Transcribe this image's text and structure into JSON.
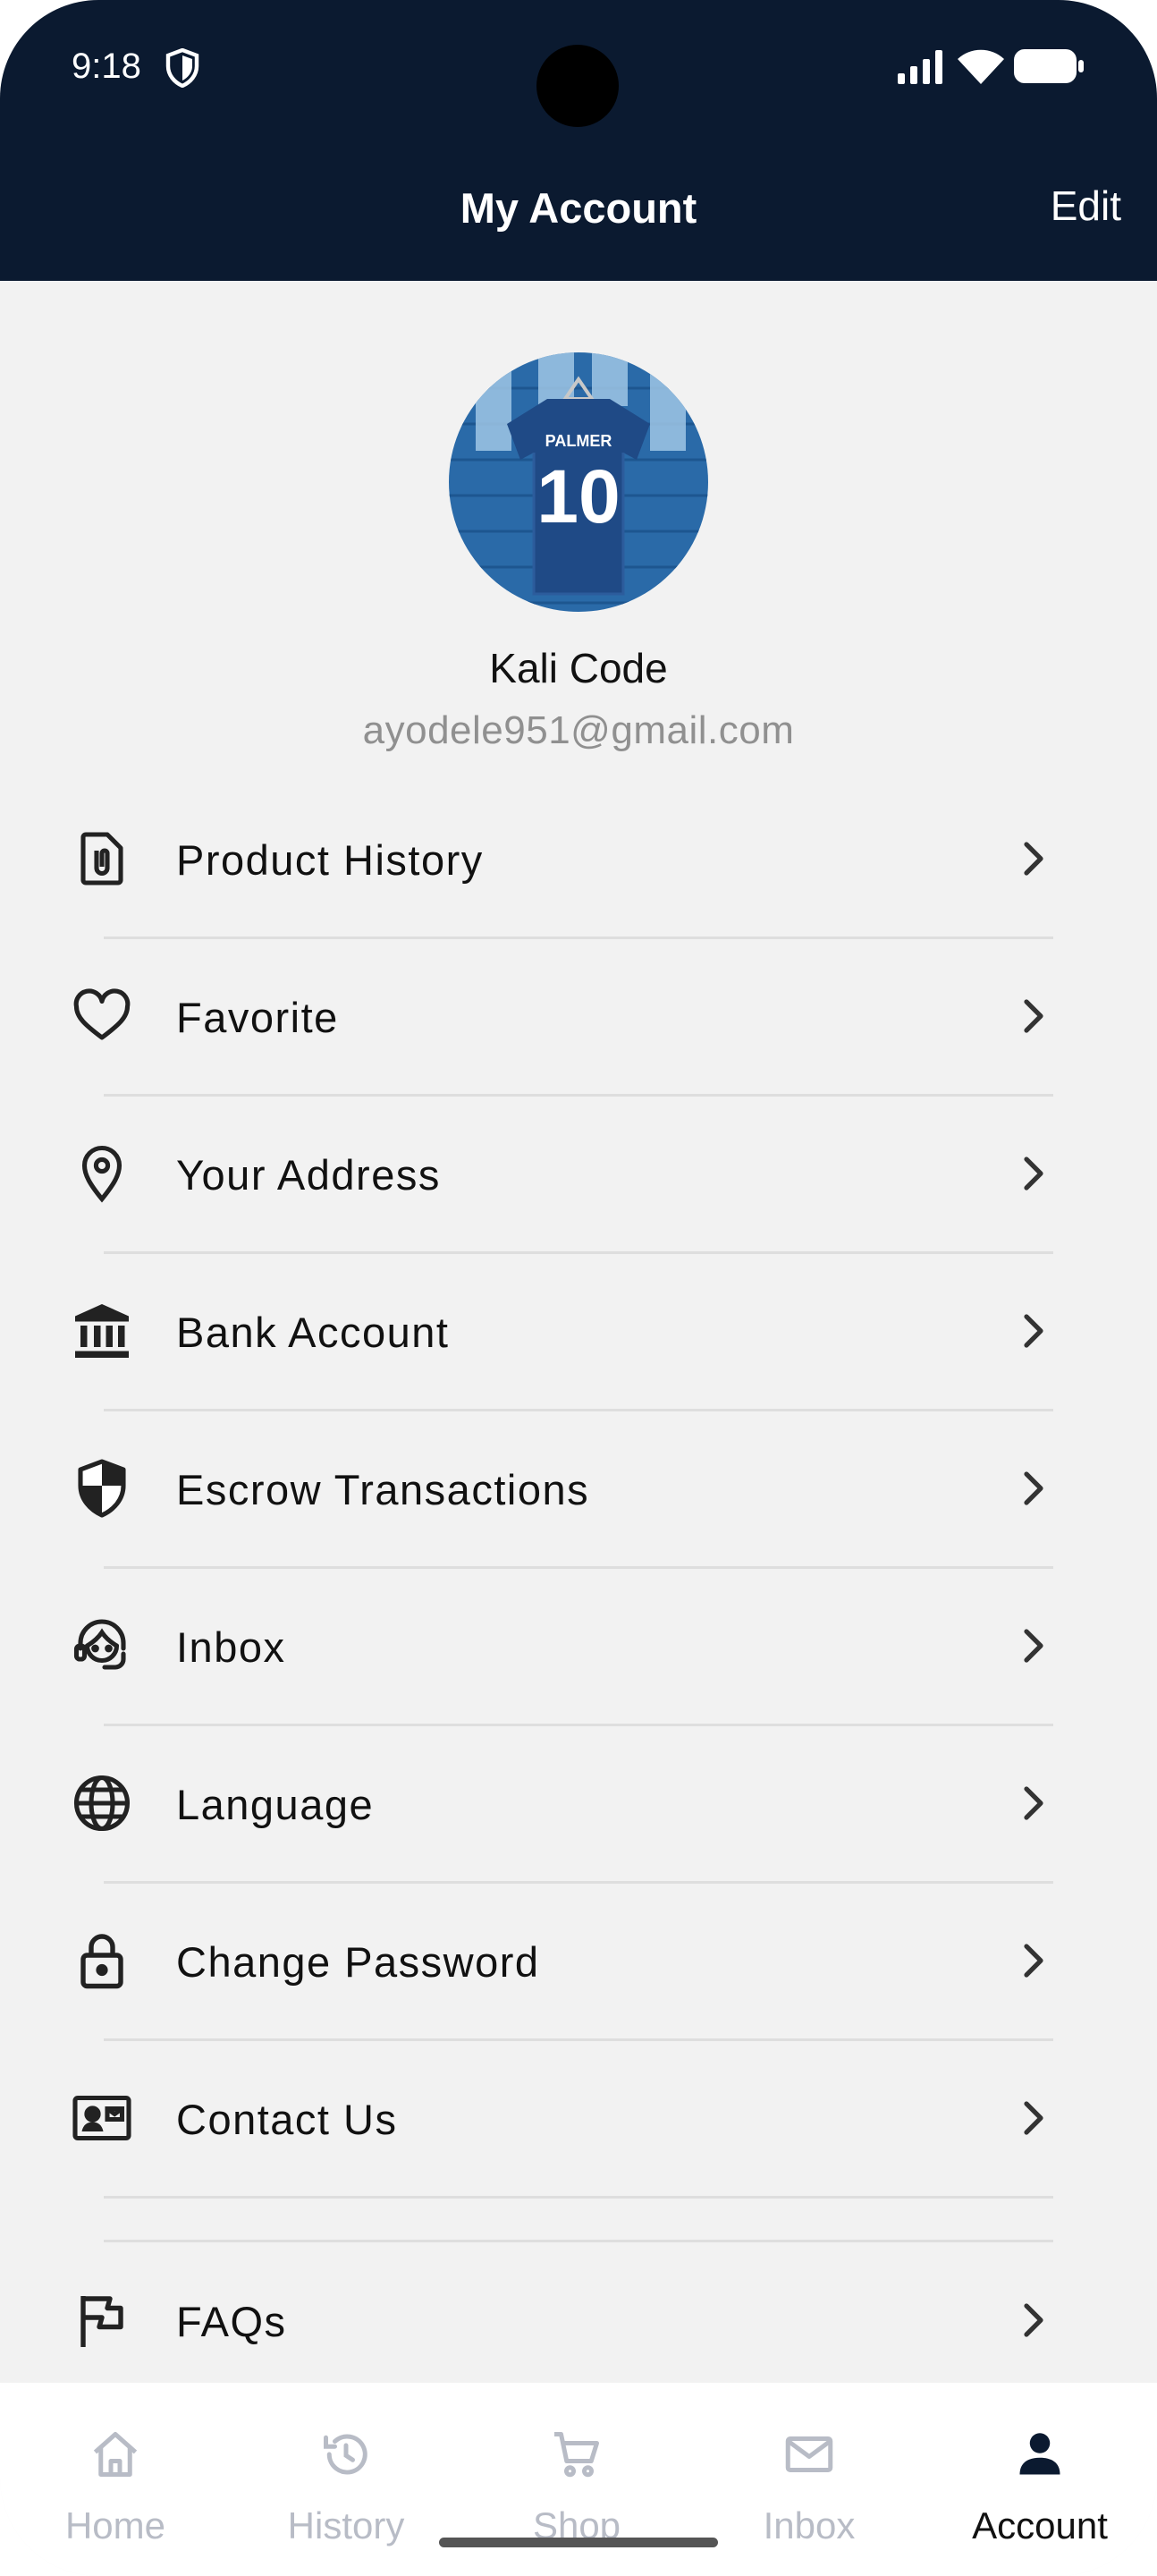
{
  "status_bar": {
    "time": "9:18"
  },
  "header": {
    "title": "My Account",
    "edit_label": "Edit"
  },
  "profile": {
    "name": "Kali Code",
    "email": "ayodele951@gmail.com",
    "jersey_name": "PALMER",
    "jersey_number": "10"
  },
  "menu": [
    {
      "label": "Product History",
      "icon": "clipboard-attachment-icon"
    },
    {
      "label": "Favorite",
      "icon": "heart-icon"
    },
    {
      "label": "Your Address",
      "icon": "location-pin-icon"
    },
    {
      "label": "Bank Account",
      "icon": "bank-icon"
    },
    {
      "label": "Escrow Transactions",
      "icon": "shield-icon"
    },
    {
      "label": "Inbox",
      "icon": "support-agent-icon"
    },
    {
      "label": "Language",
      "icon": "globe-icon"
    },
    {
      "label": "Change Password",
      "icon": "lock-icon"
    },
    {
      "label": "Contact Us",
      "icon": "contact-card-icon"
    },
    {
      "label": "FAQs",
      "icon": "flag-icon"
    }
  ],
  "tabs": [
    {
      "label": "Home",
      "icon": "home-icon"
    },
    {
      "label": "History",
      "icon": "history-icon"
    },
    {
      "label": "Shop",
      "icon": "cart-icon"
    },
    {
      "label": "Inbox",
      "icon": "mail-icon"
    },
    {
      "label": "Account",
      "icon": "person-icon",
      "active": true
    }
  ],
  "colors": {
    "header_bg": "#0b1a30",
    "page_bg": "#f2f2f2",
    "tab_inactive": "#b8bcc6",
    "tab_active": "#111111"
  }
}
